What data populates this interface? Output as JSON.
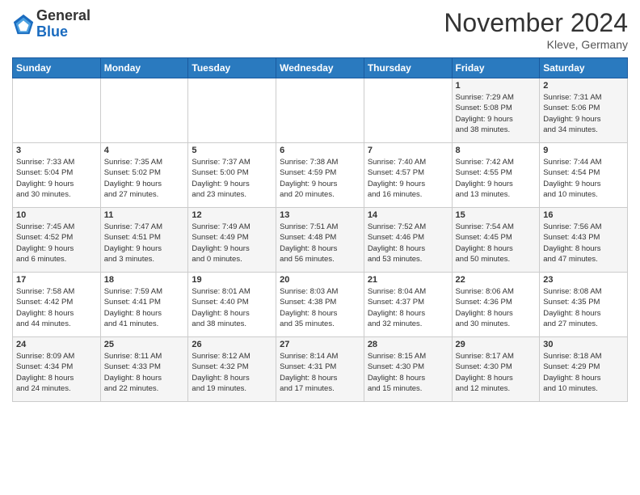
{
  "header": {
    "logo_general": "General",
    "logo_blue": "Blue",
    "title": "November 2024",
    "location": "Kleve, Germany"
  },
  "weekdays": [
    "Sunday",
    "Monday",
    "Tuesday",
    "Wednesday",
    "Thursday",
    "Friday",
    "Saturday"
  ],
  "weeks": [
    [
      {
        "day": "",
        "info": ""
      },
      {
        "day": "",
        "info": ""
      },
      {
        "day": "",
        "info": ""
      },
      {
        "day": "",
        "info": ""
      },
      {
        "day": "",
        "info": ""
      },
      {
        "day": "1",
        "info": "Sunrise: 7:29 AM\nSunset: 5:08 PM\nDaylight: 9 hours\nand 38 minutes."
      },
      {
        "day": "2",
        "info": "Sunrise: 7:31 AM\nSunset: 5:06 PM\nDaylight: 9 hours\nand 34 minutes."
      }
    ],
    [
      {
        "day": "3",
        "info": "Sunrise: 7:33 AM\nSunset: 5:04 PM\nDaylight: 9 hours\nand 30 minutes."
      },
      {
        "day": "4",
        "info": "Sunrise: 7:35 AM\nSunset: 5:02 PM\nDaylight: 9 hours\nand 27 minutes."
      },
      {
        "day": "5",
        "info": "Sunrise: 7:37 AM\nSunset: 5:00 PM\nDaylight: 9 hours\nand 23 minutes."
      },
      {
        "day": "6",
        "info": "Sunrise: 7:38 AM\nSunset: 4:59 PM\nDaylight: 9 hours\nand 20 minutes."
      },
      {
        "day": "7",
        "info": "Sunrise: 7:40 AM\nSunset: 4:57 PM\nDaylight: 9 hours\nand 16 minutes."
      },
      {
        "day": "8",
        "info": "Sunrise: 7:42 AM\nSunset: 4:55 PM\nDaylight: 9 hours\nand 13 minutes."
      },
      {
        "day": "9",
        "info": "Sunrise: 7:44 AM\nSunset: 4:54 PM\nDaylight: 9 hours\nand 10 minutes."
      }
    ],
    [
      {
        "day": "10",
        "info": "Sunrise: 7:45 AM\nSunset: 4:52 PM\nDaylight: 9 hours\nand 6 minutes."
      },
      {
        "day": "11",
        "info": "Sunrise: 7:47 AM\nSunset: 4:51 PM\nDaylight: 9 hours\nand 3 minutes."
      },
      {
        "day": "12",
        "info": "Sunrise: 7:49 AM\nSunset: 4:49 PM\nDaylight: 9 hours\nand 0 minutes."
      },
      {
        "day": "13",
        "info": "Sunrise: 7:51 AM\nSunset: 4:48 PM\nDaylight: 8 hours\nand 56 minutes."
      },
      {
        "day": "14",
        "info": "Sunrise: 7:52 AM\nSunset: 4:46 PM\nDaylight: 8 hours\nand 53 minutes."
      },
      {
        "day": "15",
        "info": "Sunrise: 7:54 AM\nSunset: 4:45 PM\nDaylight: 8 hours\nand 50 minutes."
      },
      {
        "day": "16",
        "info": "Sunrise: 7:56 AM\nSunset: 4:43 PM\nDaylight: 8 hours\nand 47 minutes."
      }
    ],
    [
      {
        "day": "17",
        "info": "Sunrise: 7:58 AM\nSunset: 4:42 PM\nDaylight: 8 hours\nand 44 minutes."
      },
      {
        "day": "18",
        "info": "Sunrise: 7:59 AM\nSunset: 4:41 PM\nDaylight: 8 hours\nand 41 minutes."
      },
      {
        "day": "19",
        "info": "Sunrise: 8:01 AM\nSunset: 4:40 PM\nDaylight: 8 hours\nand 38 minutes."
      },
      {
        "day": "20",
        "info": "Sunrise: 8:03 AM\nSunset: 4:38 PM\nDaylight: 8 hours\nand 35 minutes."
      },
      {
        "day": "21",
        "info": "Sunrise: 8:04 AM\nSunset: 4:37 PM\nDaylight: 8 hours\nand 32 minutes."
      },
      {
        "day": "22",
        "info": "Sunrise: 8:06 AM\nSunset: 4:36 PM\nDaylight: 8 hours\nand 30 minutes."
      },
      {
        "day": "23",
        "info": "Sunrise: 8:08 AM\nSunset: 4:35 PM\nDaylight: 8 hours\nand 27 minutes."
      }
    ],
    [
      {
        "day": "24",
        "info": "Sunrise: 8:09 AM\nSunset: 4:34 PM\nDaylight: 8 hours\nand 24 minutes."
      },
      {
        "day": "25",
        "info": "Sunrise: 8:11 AM\nSunset: 4:33 PM\nDaylight: 8 hours\nand 22 minutes."
      },
      {
        "day": "26",
        "info": "Sunrise: 8:12 AM\nSunset: 4:32 PM\nDaylight: 8 hours\nand 19 minutes."
      },
      {
        "day": "27",
        "info": "Sunrise: 8:14 AM\nSunset: 4:31 PM\nDaylight: 8 hours\nand 17 minutes."
      },
      {
        "day": "28",
        "info": "Sunrise: 8:15 AM\nSunset: 4:30 PM\nDaylight: 8 hours\nand 15 minutes."
      },
      {
        "day": "29",
        "info": "Sunrise: 8:17 AM\nSunset: 4:30 PM\nDaylight: 8 hours\nand 12 minutes."
      },
      {
        "day": "30",
        "info": "Sunrise: 8:18 AM\nSunset: 4:29 PM\nDaylight: 8 hours\nand 10 minutes."
      }
    ]
  ]
}
